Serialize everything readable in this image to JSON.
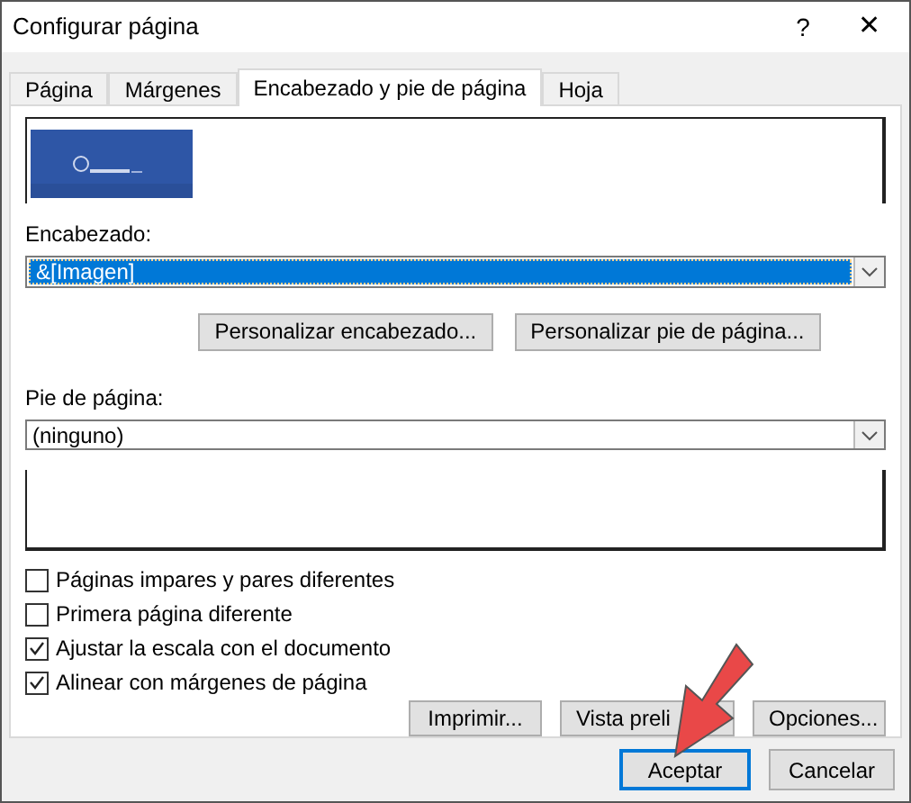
{
  "window": {
    "title": "Configurar página",
    "help": "?",
    "close": "✕"
  },
  "tabs": [
    {
      "label": "Página",
      "selected": false
    },
    {
      "label": "Márgenes",
      "selected": false
    },
    {
      "label": "Encabezado y pie de página",
      "selected": true
    },
    {
      "label": "Hoja",
      "selected": false
    }
  ],
  "header_preview": {
    "kind": "picture"
  },
  "header": {
    "label": "Encabezado:",
    "value": "&[Imagen]",
    "selected": true
  },
  "customize_buttons": [
    "Personalizar encabezado...",
    "Personalizar pie de página..."
  ],
  "footer": {
    "label": "Pie de página:",
    "value": "(ninguno)",
    "selected": false
  },
  "options": [
    {
      "label": "Páginas impares y pares diferentes",
      "checked": false
    },
    {
      "label": "Primera página diferente",
      "checked": false
    },
    {
      "label": "Ajustar la escala con el documento",
      "checked": true
    },
    {
      "label": "Alinear con márgenes de página",
      "checked": true
    }
  ],
  "action_buttons": [
    "Imprimir...",
    "Vista preli",
    "Opciones..."
  ],
  "dialog_buttons": [
    {
      "label": "Aceptar",
      "selected": true
    },
    {
      "label": "Cancelar",
      "selected": false
    }
  ],
  "annotation": {
    "kind": "arrow"
  }
}
